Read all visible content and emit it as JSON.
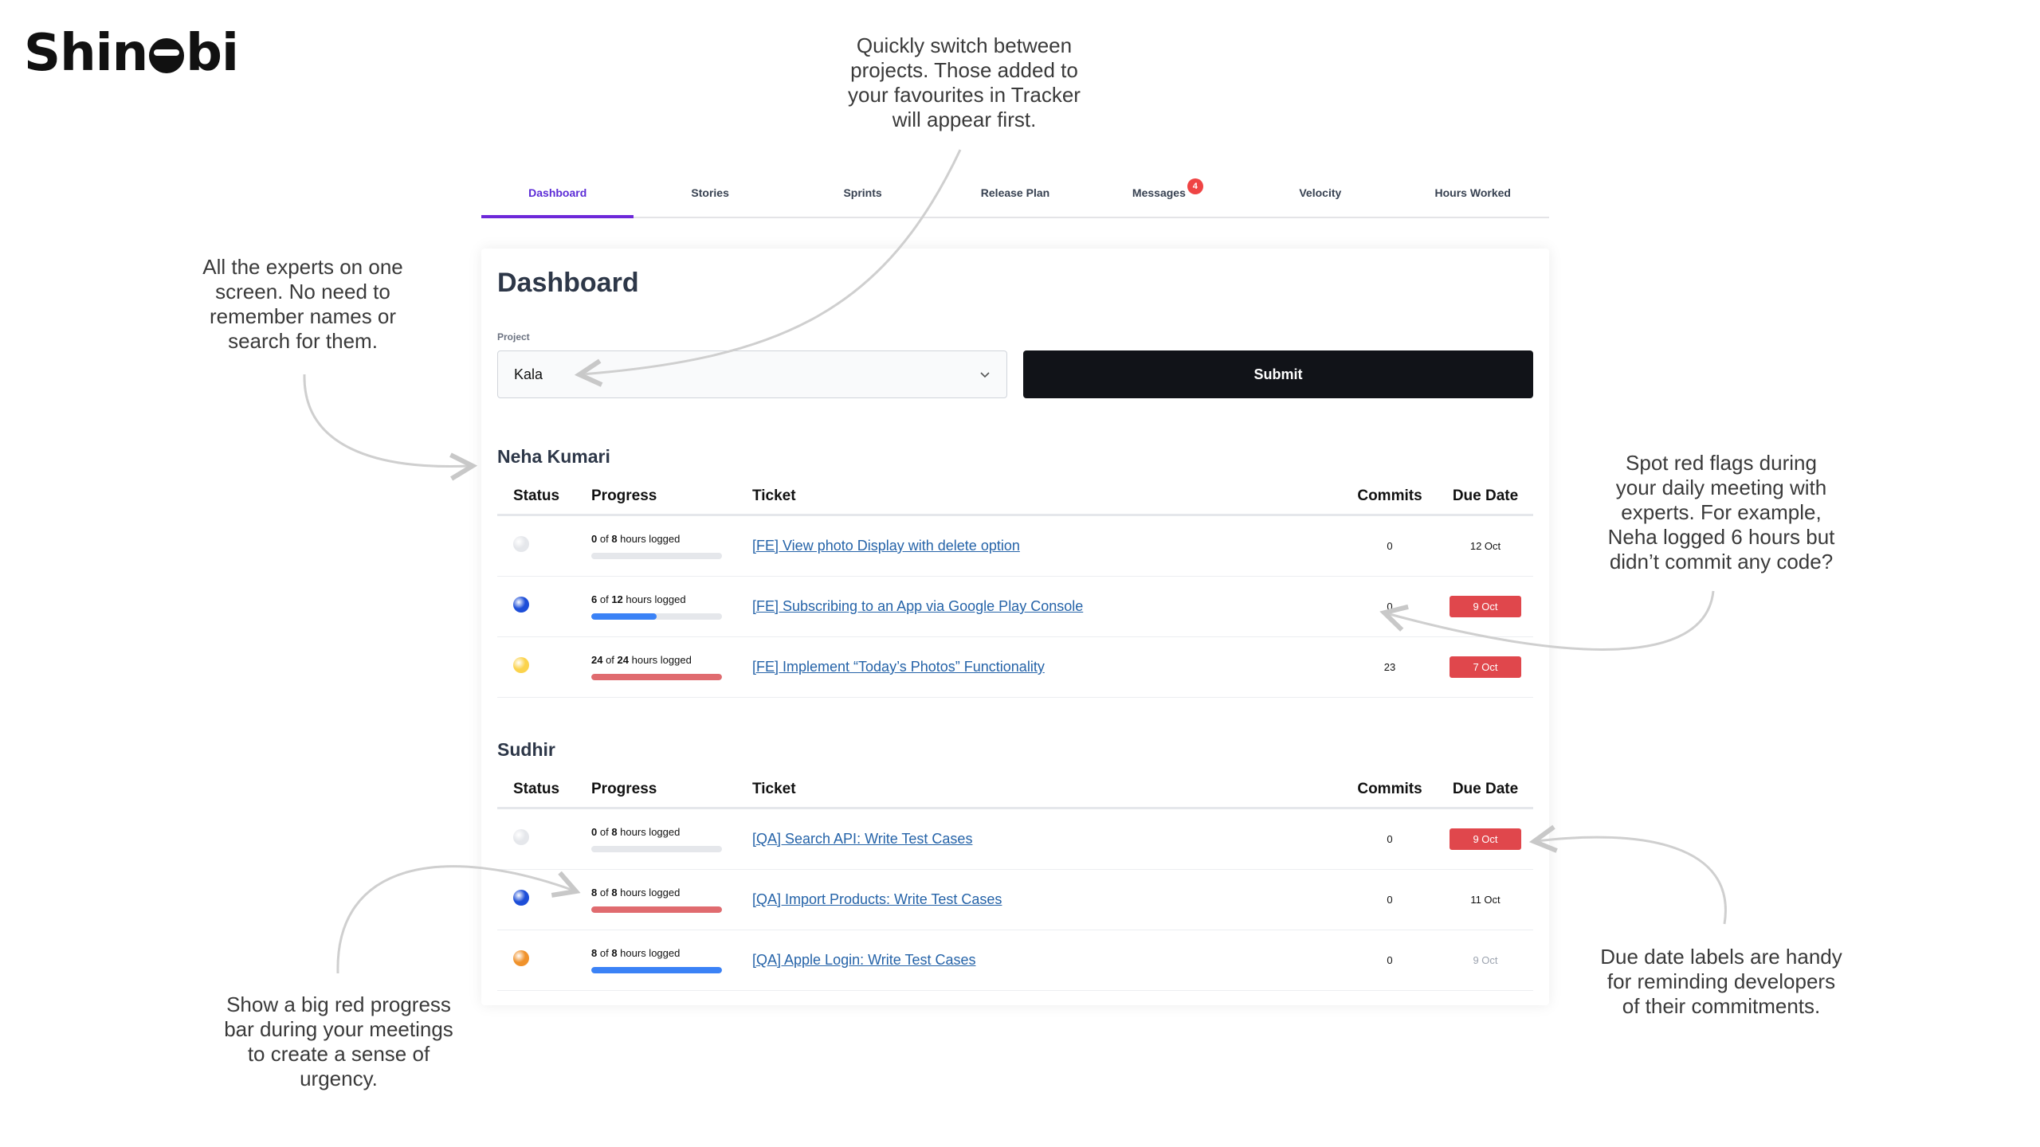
{
  "brand": {
    "logo_prefix": "Shin",
    "logo_suffix": "bi"
  },
  "annotations": {
    "projects": [
      "Quickly switch between",
      "projects. Those added to",
      "your favourites in Tracker",
      "will appear first."
    ],
    "experts": [
      "All the experts on one",
      "screen. No need to",
      "remember names or",
      "search for them."
    ],
    "red_flags": [
      "Spot red flags during",
      "your daily meeting with",
      "experts. For example,",
      "Neha logged 6 hours but",
      "didn’t commit any code?"
    ],
    "progress_bar": [
      "Show a big red progress",
      "bar during your meetings",
      "to create a sense of",
      "urgency."
    ],
    "due_dates": [
      "Due date labels are handy",
      "for reminding developers",
      "of their commitments."
    ]
  },
  "tabs": [
    {
      "label": "Dashboard",
      "active": true
    },
    {
      "label": "Stories"
    },
    {
      "label": "Sprints"
    },
    {
      "label": "Release Plan"
    },
    {
      "label": "Messages",
      "badge": "4"
    },
    {
      "label": "Velocity"
    },
    {
      "label": "Hours Worked"
    }
  ],
  "dashboard": {
    "title": "Dashboard",
    "project_label": "Project",
    "project_value": "Kala",
    "submit_label": "Submit"
  },
  "columns": {
    "status": "Status",
    "progress": "Progress",
    "ticket": "Ticket",
    "commits": "Commits",
    "due": "Due Date"
  },
  "colors": {
    "accent": "#6d28d9",
    "overdue": "#e0474c",
    "progress_blue": "#3b82f6",
    "progress_red": "#e06b6f",
    "link": "#2563a8"
  },
  "experts": [
    {
      "name": "Neha Kumari",
      "tickets": [
        {
          "status_color": "#e5e7eb",
          "logged": "0",
          "total": "8",
          "progress_suffix": "hours logged",
          "progress": 0,
          "bar_color": "#3b82f6",
          "ticket": "[FE] View photo Display with delete option",
          "commits": "0",
          "due": "12 Oct",
          "due_style": "normal"
        },
        {
          "status_color": "#1d4ed8",
          "logged": "6",
          "total": "12",
          "progress_suffix": "hours logged",
          "progress": 0.5,
          "bar_color": "#3b82f6",
          "ticket": "[FE] Subscribing to an App via Google Play Console",
          "commits": "0",
          "due": "9 Oct",
          "due_style": "overdue"
        },
        {
          "status_color": "#fbd34d",
          "logged": "24",
          "total": "24",
          "progress_suffix": "hours logged",
          "progress": 1,
          "bar_color": "#e06b6f",
          "ticket": "[FE] Implement “Today’s Photos” Functionality",
          "commits": "23",
          "due": "7 Oct",
          "due_style": "overdue"
        }
      ]
    },
    {
      "name": "Sudhir",
      "tickets": [
        {
          "status_color": "#e5e7eb",
          "logged": "0",
          "total": "8",
          "progress_suffix": "hours logged",
          "progress": 0,
          "bar_color": "#3b82f6",
          "ticket": "[QA] Search API: Write Test Cases",
          "commits": "0",
          "due": "9 Oct",
          "due_style": "overdue"
        },
        {
          "status_color": "#1d4ed8",
          "logged": "8",
          "total": "8",
          "progress_suffix": "hours logged",
          "progress": 1,
          "bar_color": "#e06b6f",
          "ticket": "[QA] Import Products: Write Test Cases",
          "commits": "0",
          "due": "11 Oct",
          "due_style": "normal"
        },
        {
          "status_color": "#f0922b",
          "logged": "8",
          "total": "8",
          "progress_suffix": "hours logged",
          "progress": 1,
          "bar_color": "#3b82f6",
          "ticket": "[QA] Apple Login: Write Test Cases",
          "commits": "0",
          "due": "9 Oct",
          "due_style": "muted"
        }
      ]
    }
  ]
}
